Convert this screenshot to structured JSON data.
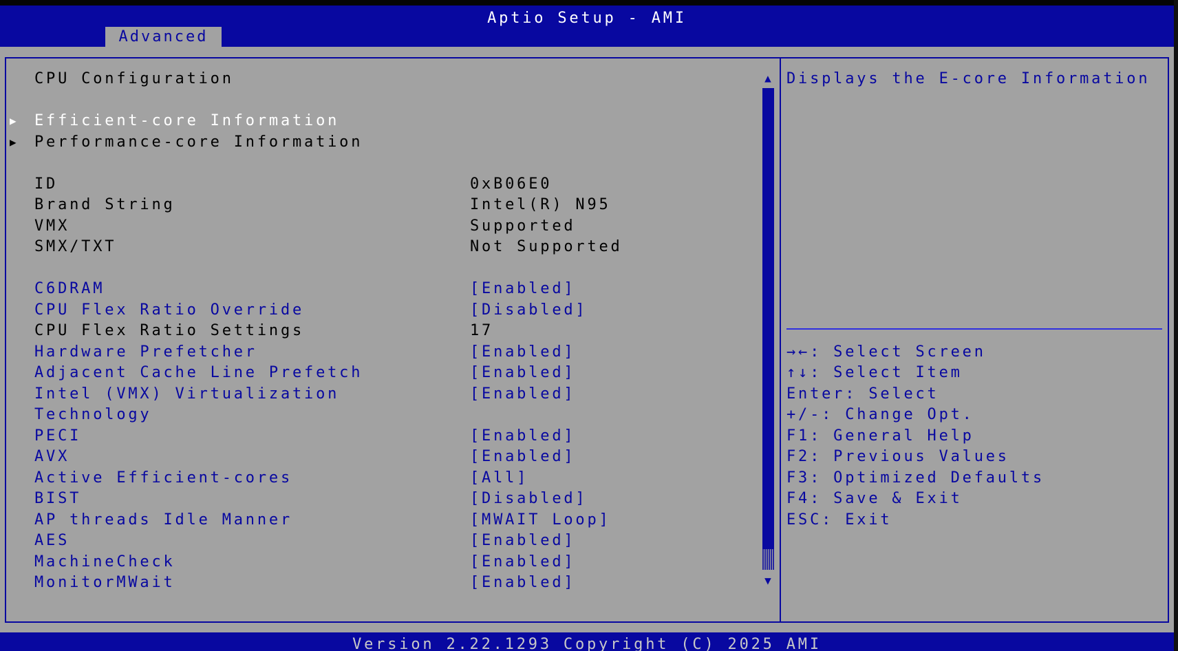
{
  "header": {
    "title": "Aptio Setup - AMI",
    "active_tab": "Advanced"
  },
  "main": {
    "page_title": "CPU Configuration",
    "submenus": [
      {
        "label": "Efficient-core Information"
      },
      {
        "label": "Performance-core Information"
      }
    ],
    "info": [
      {
        "label": "ID",
        "value": "0xB06E0"
      },
      {
        "label": "Brand String",
        "value": "Intel(R) N95"
      },
      {
        "label": "VMX",
        "value": "Supported"
      },
      {
        "label": "SMX/TXT",
        "value": "Not Supported"
      }
    ],
    "settings": [
      {
        "label": "C6DRAM",
        "value": "[Enabled]"
      },
      {
        "label": "CPU Flex Ratio Override",
        "value": "[Disabled]"
      },
      {
        "label": "CPU Flex Ratio Settings",
        "value": "17"
      },
      {
        "label": "Hardware Prefetcher",
        "value": "[Enabled]"
      },
      {
        "label": "Adjacent Cache Line Prefetch",
        "value": "[Enabled]"
      },
      {
        "label": "Intel (VMX) Virtualization",
        "label2": "Technology",
        "value": "[Enabled]"
      },
      {
        "label": "PECI",
        "value": "[Enabled]"
      },
      {
        "label": "AVX",
        "value": "[Enabled]"
      },
      {
        "label": "Active Efficient-cores",
        "value": "[All]"
      },
      {
        "label": "BIST",
        "value": "[Disabled]"
      },
      {
        "label": "AP threads Idle Manner",
        "value": "[MWAIT Loop]"
      },
      {
        "label": "AES",
        "value": "[Enabled]"
      },
      {
        "label": "MachineCheck",
        "value": "[Enabled]"
      },
      {
        "label": "MonitorMWait",
        "value": "[Enabled]"
      }
    ]
  },
  "help": {
    "description": "Displays the E-core Information",
    "keys": [
      "→←: Select Screen",
      "↑↓: Select Item",
      "Enter: Select",
      "+/-: Change Opt.",
      "F1: General Help",
      "F2: Previous Values",
      "F3: Optimized Defaults",
      "F4: Save & Exit",
      "ESC: Exit"
    ]
  },
  "footer": {
    "text": "Version 2.22.1293 Copyright (C) 2025 AMI"
  },
  "colors": {
    "blue": "#0808a0",
    "gray": "#a2a2a2"
  }
}
